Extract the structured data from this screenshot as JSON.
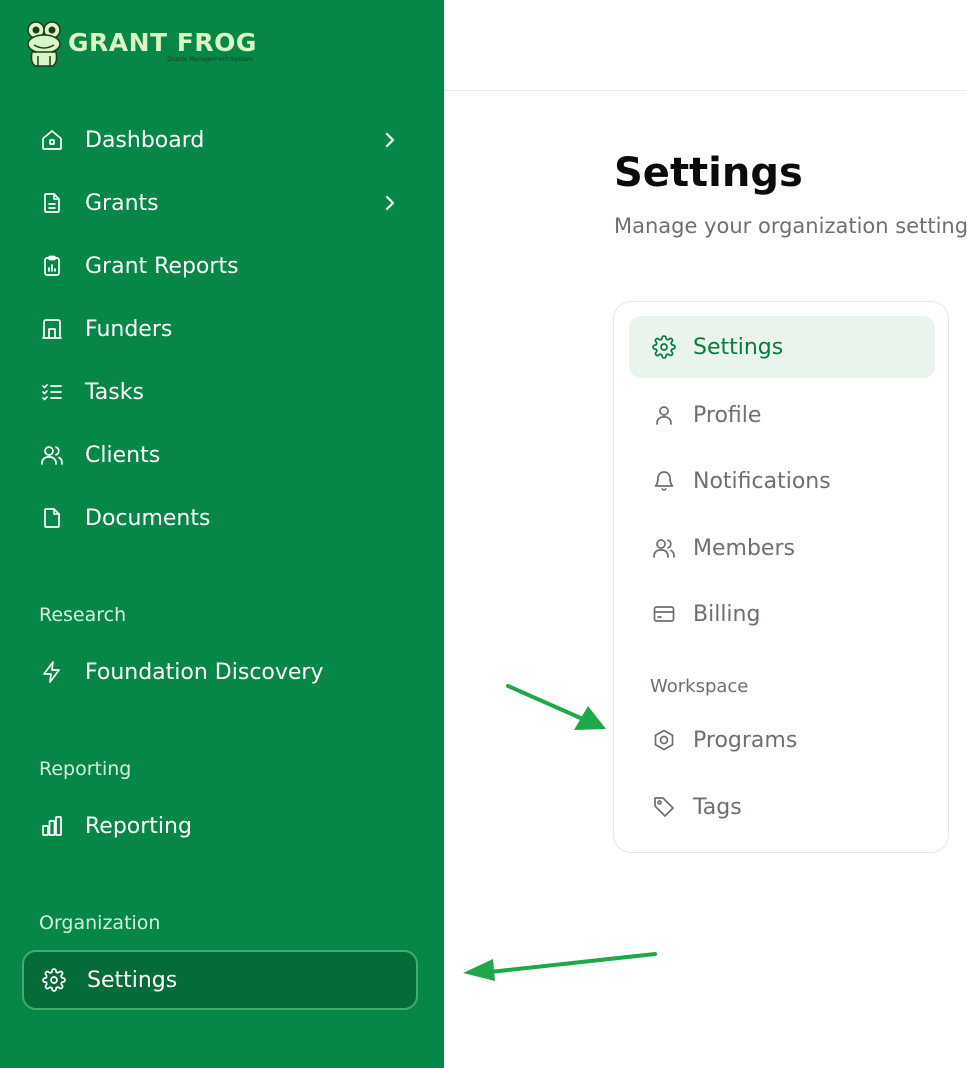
{
  "brand": {
    "name": "GRANT FROG",
    "tagline": "Grants Management System",
    "colors": {
      "sidebar": "#068747",
      "active_item": "#056b38",
      "accent_green": "#0b7a40",
      "arrow": "#1fa84a"
    }
  },
  "sidebar": {
    "items": [
      {
        "label": "Dashboard",
        "icon": "home-icon",
        "has_chevron": true
      },
      {
        "label": "Grants",
        "icon": "file-text-icon",
        "has_chevron": true
      },
      {
        "label": "Grant Reports",
        "icon": "clipboard-chart-icon",
        "has_chevron": false
      },
      {
        "label": "Funders",
        "icon": "building-icon",
        "has_chevron": false
      },
      {
        "label": "Tasks",
        "icon": "list-checks-icon",
        "has_chevron": false
      },
      {
        "label": "Clients",
        "icon": "users-icon",
        "has_chevron": false
      },
      {
        "label": "Documents",
        "icon": "file-icon",
        "has_chevron": false
      }
    ],
    "sections": {
      "research": {
        "label": "Research",
        "items": [
          {
            "label": "Foundation Discovery",
            "icon": "zap-icon"
          }
        ]
      },
      "reporting": {
        "label": "Reporting",
        "items": [
          {
            "label": "Reporting",
            "icon": "bar-chart-icon"
          }
        ]
      },
      "organization": {
        "label": "Organization",
        "items": [
          {
            "label": "Settings",
            "icon": "gear-icon",
            "active": true
          }
        ]
      }
    }
  },
  "main": {
    "title": "Settings",
    "subtitle": "Manage your organization settings",
    "settings_nav": {
      "items": [
        {
          "label": "Settings",
          "icon": "gear-icon",
          "active": true
        },
        {
          "label": "Profile",
          "icon": "user-icon"
        },
        {
          "label": "Notifications",
          "icon": "bell-icon"
        },
        {
          "label": "Members",
          "icon": "users-icon"
        },
        {
          "label": "Billing",
          "icon": "credit-card-icon"
        }
      ],
      "workspace": {
        "label": "Workspace",
        "items": [
          {
            "label": "Programs",
            "icon": "hexagon-icon"
          },
          {
            "label": "Tags",
            "icon": "tag-icon"
          }
        ]
      }
    }
  }
}
